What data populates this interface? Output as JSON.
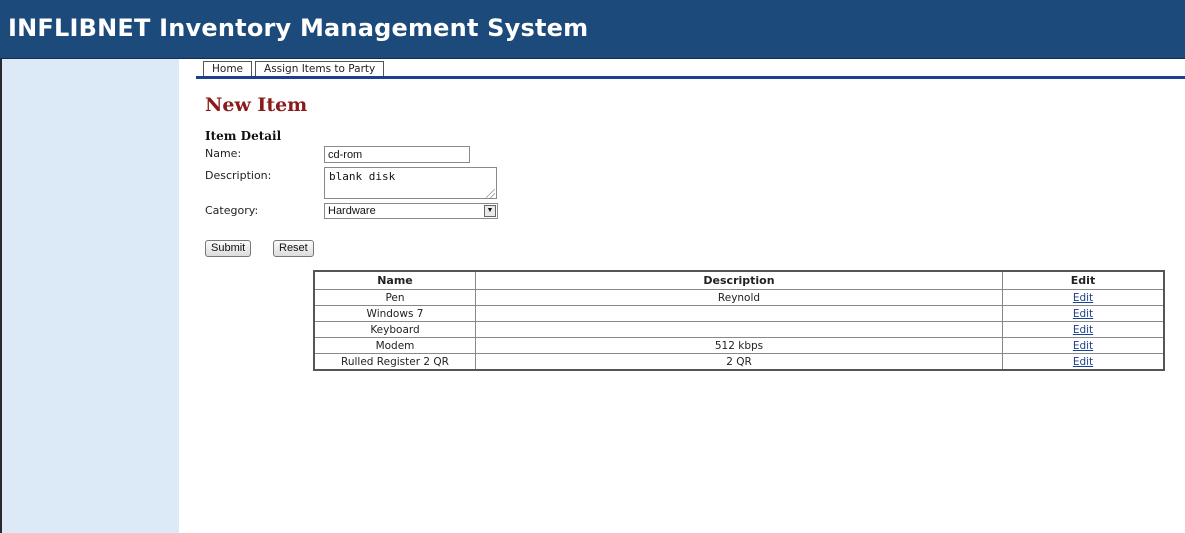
{
  "header": {
    "title": "INFLIBNET Inventory Management System"
  },
  "nav": {
    "items": [
      {
        "label": "Home"
      },
      {
        "label": "Assign Items to Party"
      }
    ]
  },
  "page": {
    "title": "New Item",
    "section": "Item Detail"
  },
  "form": {
    "name_label": "Name:",
    "name_value": "cd-rom",
    "description_label": "Description:",
    "description_value": "blank disk",
    "category_label": "Category:",
    "category_value": "Hardware",
    "submit_label": "Submit",
    "reset_label": "Reset"
  },
  "table": {
    "headers": [
      "Name",
      "Description",
      "Edit"
    ],
    "rows": [
      {
        "name": "Pen",
        "description": "Reynold",
        "edit": "Edit"
      },
      {
        "name": "Windows 7",
        "description": "",
        "edit": "Edit"
      },
      {
        "name": "Keyboard",
        "description": "",
        "edit": "Edit"
      },
      {
        "name": "Modem",
        "description": "512 kbps",
        "edit": "Edit"
      },
      {
        "name": "Rulled Register 2 QR",
        "description": "2 QR",
        "edit": "Edit"
      }
    ]
  },
  "icons": {
    "select_arrow": "chevron-down-icon",
    "textarea_grip": "resize-grip-icon"
  },
  "colors": {
    "header_bg": "#1c4a7a",
    "sidebar_bg": "#dce9f6",
    "title_red": "#8b1a1a",
    "nav_line": "#1c3f8f"
  }
}
